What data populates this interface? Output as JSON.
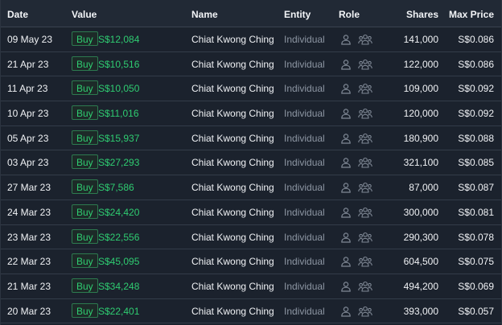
{
  "columns": {
    "date": "Date",
    "value": "Value",
    "name": "Name",
    "entity": "Entity",
    "role": "Role",
    "shares": "Shares",
    "max_price": "Max Price"
  },
  "colors": {
    "buy": "#2fcc71",
    "background": "#1b222d",
    "header_bg": "#212935"
  },
  "icons": {
    "role_person": "person-icon",
    "role_group": "group-icon"
  },
  "rows": [
    {
      "date": "09 May 23",
      "action": "Buy",
      "value": "S$12,084",
      "name": "Chiat Kwong Ching",
      "entity": "Individual",
      "shares": "141,000",
      "max_price": "S$0.086"
    },
    {
      "date": "21 Apr 23",
      "action": "Buy",
      "value": "S$10,516",
      "name": "Chiat Kwong Ching",
      "entity": "Individual",
      "shares": "122,000",
      "max_price": "S$0.086"
    },
    {
      "date": "11 Apr 23",
      "action": "Buy",
      "value": "S$10,050",
      "name": "Chiat Kwong Ching",
      "entity": "Individual",
      "shares": "109,000",
      "max_price": "S$0.092"
    },
    {
      "date": "10 Apr 23",
      "action": "Buy",
      "value": "S$11,016",
      "name": "Chiat Kwong Ching",
      "entity": "Individual",
      "shares": "120,000",
      "max_price": "S$0.092"
    },
    {
      "date": "05 Apr 23",
      "action": "Buy",
      "value": "S$15,937",
      "name": "Chiat Kwong Ching",
      "entity": "Individual",
      "shares": "180,900",
      "max_price": "S$0.088"
    },
    {
      "date": "03 Apr 23",
      "action": "Buy",
      "value": "S$27,293",
      "name": "Chiat Kwong Ching",
      "entity": "Individual",
      "shares": "321,100",
      "max_price": "S$0.085"
    },
    {
      "date": "27 Mar 23",
      "action": "Buy",
      "value": "S$7,586",
      "name": "Chiat Kwong Ching",
      "entity": "Individual",
      "shares": "87,000",
      "max_price": "S$0.087"
    },
    {
      "date": "24 Mar 23",
      "action": "Buy",
      "value": "S$24,420",
      "name": "Chiat Kwong Ching",
      "entity": "Individual",
      "shares": "300,000",
      "max_price": "S$0.081"
    },
    {
      "date": "23 Mar 23",
      "action": "Buy",
      "value": "S$22,556",
      "name": "Chiat Kwong Ching",
      "entity": "Individual",
      "shares": "290,300",
      "max_price": "S$0.078"
    },
    {
      "date": "22 Mar 23",
      "action": "Buy",
      "value": "S$45,095",
      "name": "Chiat Kwong Ching",
      "entity": "Individual",
      "shares": "604,500",
      "max_price": "S$0.075"
    },
    {
      "date": "21 Mar 23",
      "action": "Buy",
      "value": "S$34,248",
      "name": "Chiat Kwong Ching",
      "entity": "Individual",
      "shares": "494,200",
      "max_price": "S$0.069"
    },
    {
      "date": "20 Mar 23",
      "action": "Buy",
      "value": "S$22,401",
      "name": "Chiat Kwong Ching",
      "entity": "Individual",
      "shares": "393,000",
      "max_price": "S$0.057"
    }
  ]
}
